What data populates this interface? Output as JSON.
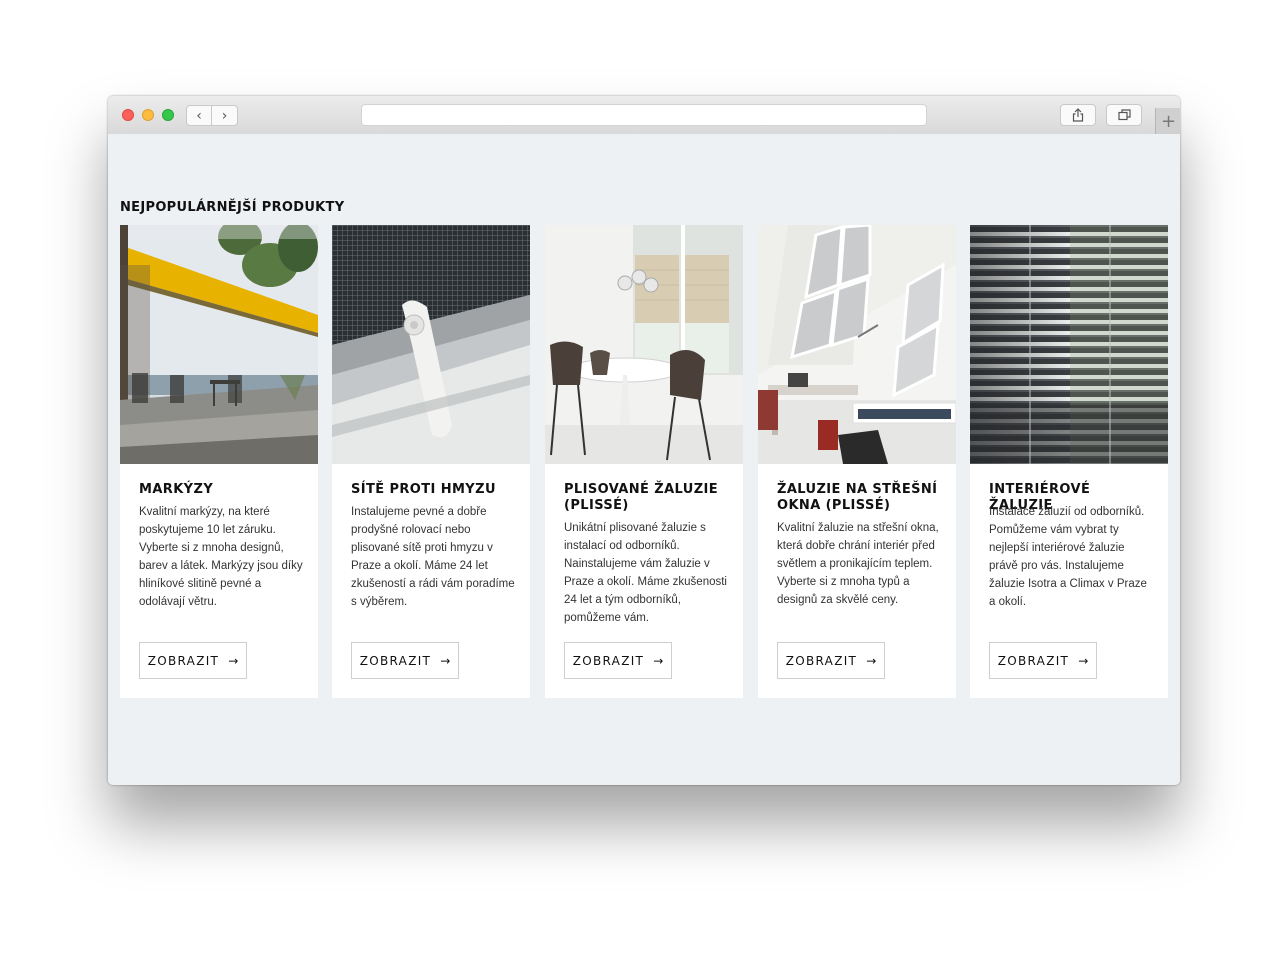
{
  "section": {
    "title": "NEJPOPULÁRNĚJŠÍ PRODUKTY"
  },
  "products": [
    {
      "title": "MARKÝZY",
      "description": "Kvalitní markýzy, na které poskytujeme 10 let záruku. Vyberte si z mnoha designů, barev a látek. Markýzy jsou díky hliníkové slitině pevné a odolávají větru.",
      "button": "ZOBRAZIT"
    },
    {
      "title": "SÍTĚ PROTI HMYZU",
      "description": "Instalujeme pevné a dobře prodyšné rolovací nebo plisované sítě proti hmyzu v Praze a okolí. Máme 24 let zkušeností a rádi vám poradíme s výběrem.",
      "button": "ZOBRAZIT"
    },
    {
      "title": "PLISOVANÉ ŽALUZIE (PLISSÉ)",
      "description": "Unikátní plisované žaluzie s instalací od odborníků. Nainstalujeme vám žaluzie v Praze a okolí. Máme zkušenosti 24 let a tým odborníků, pomůžeme vám.",
      "button": "ZOBRAZIT"
    },
    {
      "title": "ŽALUZIE NA STŘEŠNÍ OKNA (PLISSÉ)",
      "description": "Kvalitní žaluzie na střešní okna, která dobře chrání interiér před světlem a pronikajícím teplem. Vyberte si z mnoha typů a designů za skvělé ceny.",
      "button": "ZOBRAZIT"
    },
    {
      "title": "INTERIÉROVÉ ŽALUZIE",
      "description": "Instalace žaluzií od odborníků. Pomůžeme vám vybrat ty nejlepší interiérové žaluzie právě pro vás. Instalujeme žaluzie Isotra a Climax v Praze a okolí.",
      "button": "ZOBRAZIT"
    }
  ],
  "icons": {
    "back": "chevron-left-icon",
    "forward": "chevron-right-icon",
    "share": "share-icon",
    "tabs": "tabs-icon",
    "new_tab": "plus-icon",
    "button_arrow": "arrow-right-icon"
  },
  "colors": {
    "page_background": "#eef1f4",
    "card_background": "#ffffff",
    "awning_yellow": "#e8b200"
  }
}
